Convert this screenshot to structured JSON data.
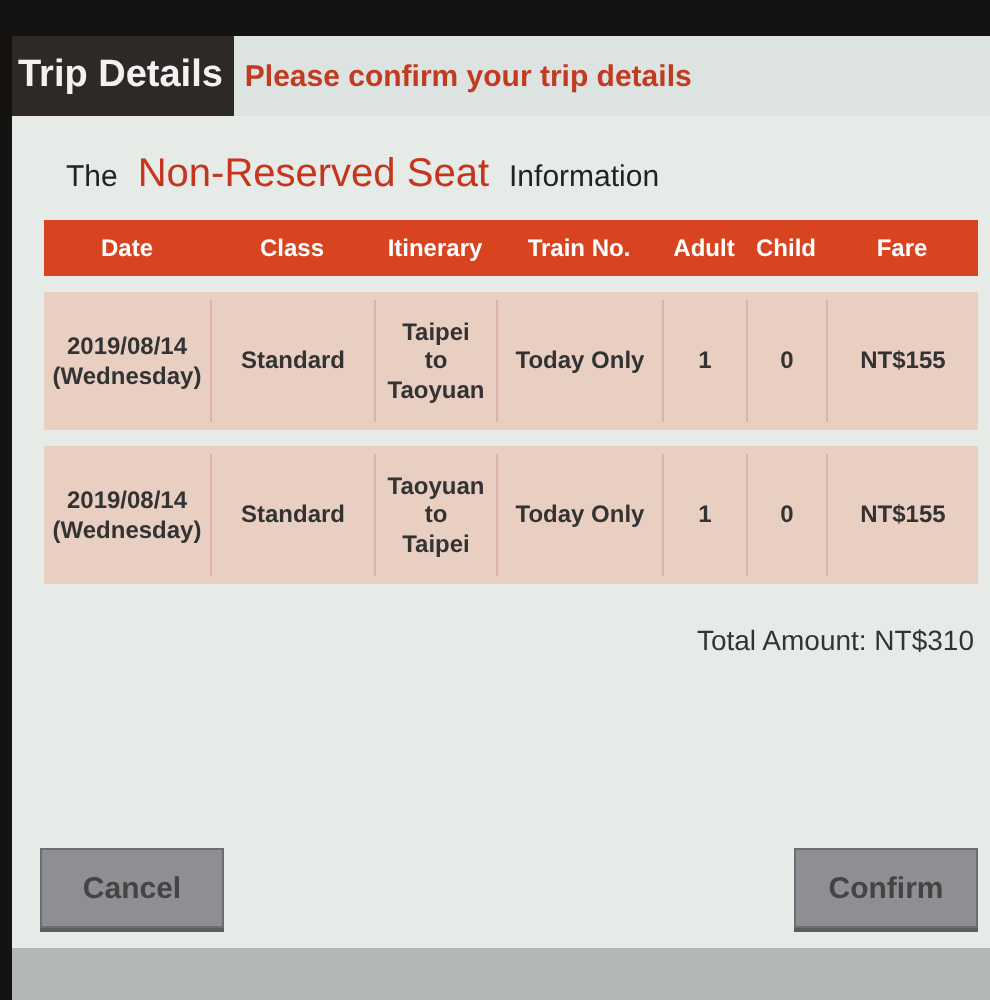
{
  "header": {
    "title": "Trip Details",
    "prompt": "Please confirm your trip details"
  },
  "heading": {
    "prefix": "The",
    "highlight": "Non-Reserved Seat",
    "suffix": "Information"
  },
  "table": {
    "columns": [
      "Date",
      "Class",
      "Itinerary",
      "Train No.",
      "Adult",
      "Child",
      "Fare"
    ],
    "rows": [
      {
        "date": [
          "2019/08/14",
          "(Wednesday)"
        ],
        "class": "Standard",
        "itinerary": [
          "Taipei",
          "to",
          "Taoyuan"
        ],
        "train": "Today Only",
        "adult": "1",
        "child": "0",
        "fare": "NT$155"
      },
      {
        "date": [
          "2019/08/14",
          "(Wednesday)"
        ],
        "class": "Standard",
        "itinerary": [
          "Taoyuan",
          "to",
          "Taipei"
        ],
        "train": "Today Only",
        "adult": "1",
        "child": "0",
        "fare": "NT$155"
      }
    ]
  },
  "total": "Total Amount: NT$310",
  "buttons": [
    "Cancel",
    "Confirm"
  ]
}
